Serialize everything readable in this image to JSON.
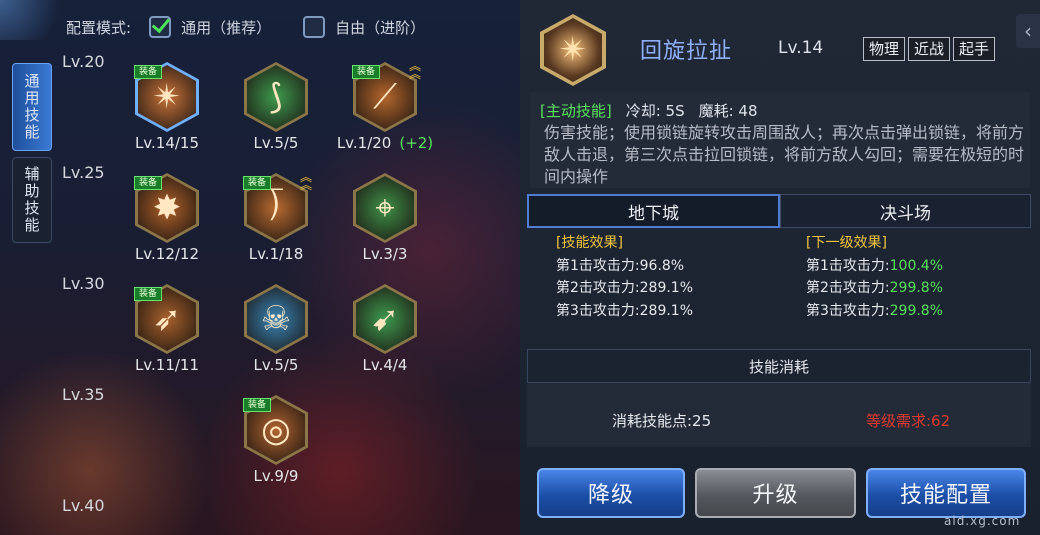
{
  "mode": {
    "label": "配置模式:",
    "options": [
      {
        "label": "通用（推荐）",
        "checked": true
      },
      {
        "label": "自由（进阶）",
        "checked": false
      }
    ]
  },
  "side_tabs": [
    {
      "label": "通用技能",
      "active": true
    },
    {
      "label": "辅助技能",
      "active": false
    }
  ],
  "level_markers": [
    "Lv.20",
    "Lv.25",
    "Lv.30",
    "Lv.35",
    "Lv.40"
  ],
  "skills": [
    {
      "level": "Lv.14/15",
      "equipped": true,
      "selected": true,
      "icon": "spinning-chain-icon",
      "color": "#c9733a"
    },
    {
      "level": "Lv.5/5",
      "equipped": false,
      "icon": "green-slash-icon",
      "color": "#3f9a4f"
    },
    {
      "level": "Lv.1/20",
      "bonus": "(+2)",
      "equipped": true,
      "rank": true,
      "icon": "claw-strike-icon",
      "color": "#b5672d"
    },
    {
      "level": "Lv.12/12",
      "equipped": true,
      "icon": "burst-icon",
      "color": "#b0612a"
    },
    {
      "level": "Lv.1/18",
      "equipped": true,
      "rank": true,
      "icon": "spear-sweep-icon",
      "color": "#b86a30"
    },
    {
      "level": "Lv.3/3",
      "equipped": false,
      "icon": "crossbow-icon",
      "color": "#3f8f48"
    },
    {
      "level": "Lv.11/11",
      "equipped": true,
      "icon": "dash-icon",
      "color": "#a8612c"
    },
    {
      "level": "Lv.5/5",
      "equipped": false,
      "icon": "skull-icon",
      "color": "#3a86b8"
    },
    {
      "level": "Lv.4/4",
      "equipped": false,
      "icon": "leap-icon",
      "color": "#3f9a4f"
    },
    {
      "level": "Lv.9/9",
      "equipped": true,
      "icon": "target-icon",
      "color": "#b06430"
    }
  ],
  "equip_label": "装备",
  "detail": {
    "name": "回旋拉扯",
    "level": "Lv.14",
    "tags": [
      "物理",
      "近战",
      "起手"
    ],
    "type_tag": "[主动技能]",
    "cooldown": "冷却: 5S",
    "mana": "魔耗: 48",
    "description": "伤害技能；使用锁链旋转攻击周围敌人；再次点击弹出锁链，将前方敌人击退，第三次点击拉回锁链，将前方敌人勾回；需要在极短的时间内操作"
  },
  "mode_tabs": [
    "地下城",
    "决斗场"
  ],
  "effects": {
    "current_title": "[技能效果]",
    "next_title": "[下一级效果]",
    "rows": [
      {
        "label": "第1击攻击力:",
        "current": "96.8%",
        "next": "100.4%"
      },
      {
        "label": "第2击攻击力:",
        "current": "289.1%",
        "next": "299.8%"
      },
      {
        "label": "第3击攻击力:",
        "current": "289.1%",
        "next": "299.8%"
      }
    ]
  },
  "cost": {
    "header": "技能消耗",
    "sp_label": "消耗技能点:25",
    "level_req": "等级需求:62"
  },
  "buttons": {
    "downgrade": "降级",
    "upgrade": "升级",
    "config": "技能配置"
  },
  "watermark": "ald.xg.com"
}
